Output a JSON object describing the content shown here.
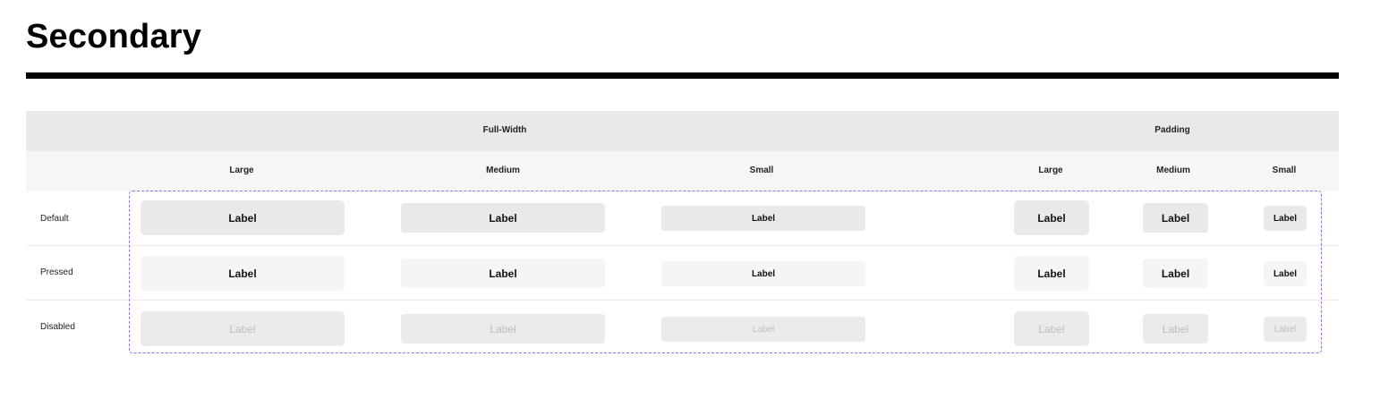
{
  "page": {
    "title": "Secondary"
  },
  "table": {
    "groups": {
      "full_width": "Full-Width",
      "padding": "Padding"
    },
    "sizes": {
      "fw_large": "Large",
      "fw_medium": "Medium",
      "fw_small": "Small",
      "pad_large": "Large",
      "pad_medium": "Medium",
      "pad_small": "Small"
    },
    "rows": {
      "default": "Default",
      "pressed": "Pressed",
      "disabled": "Disabled"
    }
  },
  "buttons": {
    "label": "Label"
  },
  "colors": {
    "frame_border": "#9b6cf0",
    "button_default_bg": "#e9e9e9",
    "button_pressed_bg": "#f5f5f5",
    "button_disabled_bg": "#ebebeb",
    "button_disabled_text": "#bdbdbd"
  }
}
